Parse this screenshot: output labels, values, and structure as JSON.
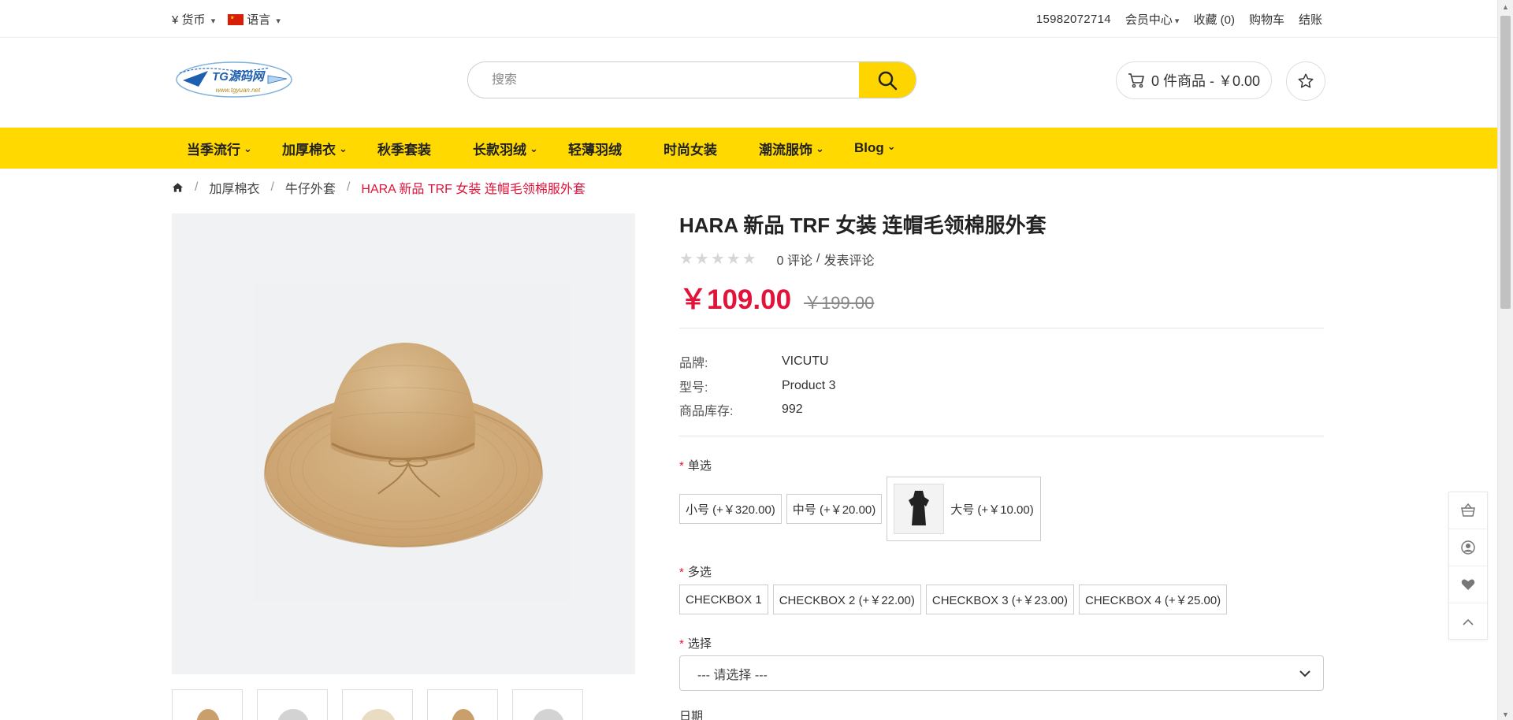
{
  "topbar": {
    "currency_symbol": "¥",
    "currency_label": "货币",
    "language_label": "语言",
    "phone": "15982072714",
    "account_label": "会员中心",
    "wishlist_label": "收藏",
    "wishlist_count": "(0)",
    "cart_label": "购物车",
    "checkout_label": "结账"
  },
  "header": {
    "logo_text": "TG源码网",
    "logo_url_text": "www.tgyuan.net",
    "search_placeholder": "搜索",
    "cart_summary": "0 件商品 - ￥0.00"
  },
  "nav": {
    "items": [
      {
        "label": "当季流行",
        "dropdown": true
      },
      {
        "label": "加厚棉衣",
        "dropdown": true
      },
      {
        "label": "秋季套装",
        "dropdown": false
      },
      {
        "label": "长款羽绒",
        "dropdown": true
      },
      {
        "label": "轻薄羽绒",
        "dropdown": false
      },
      {
        "label": "时尚女装",
        "dropdown": false
      },
      {
        "label": "潮流服饰",
        "dropdown": true
      },
      {
        "label": "Blog",
        "dropdown": true
      }
    ]
  },
  "breadcrumb": {
    "items": [
      "加厚棉衣",
      "牛仔外套"
    ],
    "current": "HARA 新品 TRF 女装 连帽毛领棉服外套"
  },
  "product": {
    "title": "HARA 新品 TRF 女装 连帽毛领棉服外套",
    "rating": 0,
    "reviews_text": "0 评论",
    "write_review_text": "发表评论",
    "review_sep": "/",
    "price": "￥109.00",
    "old_price": "￥199.00",
    "specs": [
      {
        "label": "品牌:",
        "value": "VICUTU"
      },
      {
        "label": "型号:",
        "value": "Product 3"
      },
      {
        "label": "商品库存:",
        "value": "992"
      }
    ]
  },
  "options": {
    "radio_label": "单选",
    "radio": [
      "小号 (+￥320.00)",
      "中号 (+￥20.00)",
      "大号 (+￥10.00)"
    ],
    "checkbox_label": "多选",
    "checkbox": [
      "CHECKBOX 1",
      "CHECKBOX 2 (+￥22.00)",
      "CHECKBOX 3 (+￥23.00)",
      "CHECKBOX 4 (+￥25.00)"
    ],
    "select_label": "选择",
    "select_value": "--- 请选择 ---",
    "date_label": "日期",
    "required_mark": "*"
  },
  "colors": {
    "accent": "#ffd900",
    "price": "#e2123a"
  }
}
